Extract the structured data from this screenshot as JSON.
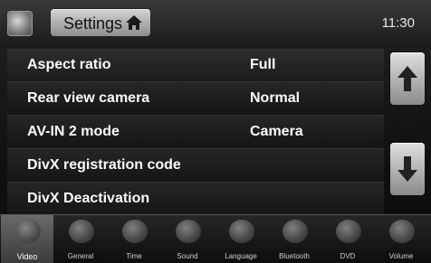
{
  "header": {
    "title": "Settings",
    "time": "11:30"
  },
  "settings": [
    {
      "label": "Aspect ratio",
      "value": "Full"
    },
    {
      "label": "Rear view camera",
      "value": "Normal"
    },
    {
      "label": "AV-IN 2 mode",
      "value": "Camera"
    },
    {
      "label": "DivX registration code",
      "value": ""
    },
    {
      "label": "DivX Deactivation",
      "value": ""
    }
  ],
  "tabs": [
    {
      "label": "Video",
      "icon": "video-icon",
      "active": true
    },
    {
      "label": "General",
      "icon": "general-icon",
      "active": false
    },
    {
      "label": "Time",
      "icon": "clock-icon",
      "active": false
    },
    {
      "label": "Sound",
      "icon": "speaker-icon",
      "active": false
    },
    {
      "label": "Language",
      "icon": "language-icon",
      "active": false
    },
    {
      "label": "Bluetooth",
      "icon": "bluetooth-icon",
      "active": false
    },
    {
      "label": "DVD",
      "icon": "disc-icon",
      "active": false
    },
    {
      "label": "Volume",
      "icon": "volume-icon",
      "active": false
    }
  ]
}
